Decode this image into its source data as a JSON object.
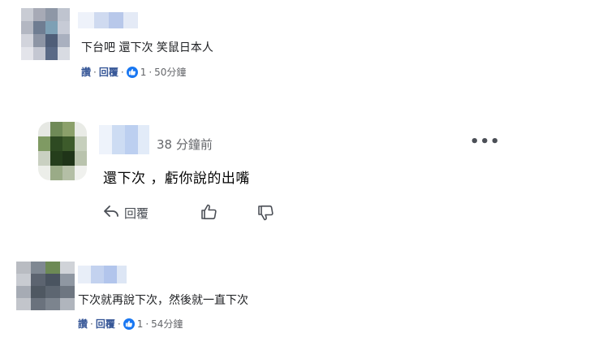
{
  "comments": [
    {
      "text": "下台吧 還下次 笑鼠日本人",
      "actions": {
        "like": "讚",
        "sep1": "·",
        "reply": "回覆",
        "sep2": "·",
        "reaction_count": "1",
        "sep3": "·",
        "time": "50分鐘"
      }
    },
    {
      "text": "下次就再說下次，然後就一直下次",
      "actions": {
        "like": "讚",
        "sep1": "·",
        "reply": "回覆",
        "sep2": "·",
        "reaction_count": "1",
        "sep3": "·",
        "time": "54分鐘"
      }
    }
  ],
  "reply": {
    "time": "38 分鐘前",
    "text": "還下次 ，虧你說的出嘴",
    "more": "•••",
    "reply_label": "回覆"
  },
  "icons": [
    "like-reaction-icon",
    "reply-arrow-icon",
    "thumbs-up-icon",
    "thumbs-down-icon",
    "more-options-icon"
  ],
  "colors": {
    "link_blue": "#385898",
    "like_blue": "#1877f2",
    "meta_gray": "#65676b"
  }
}
